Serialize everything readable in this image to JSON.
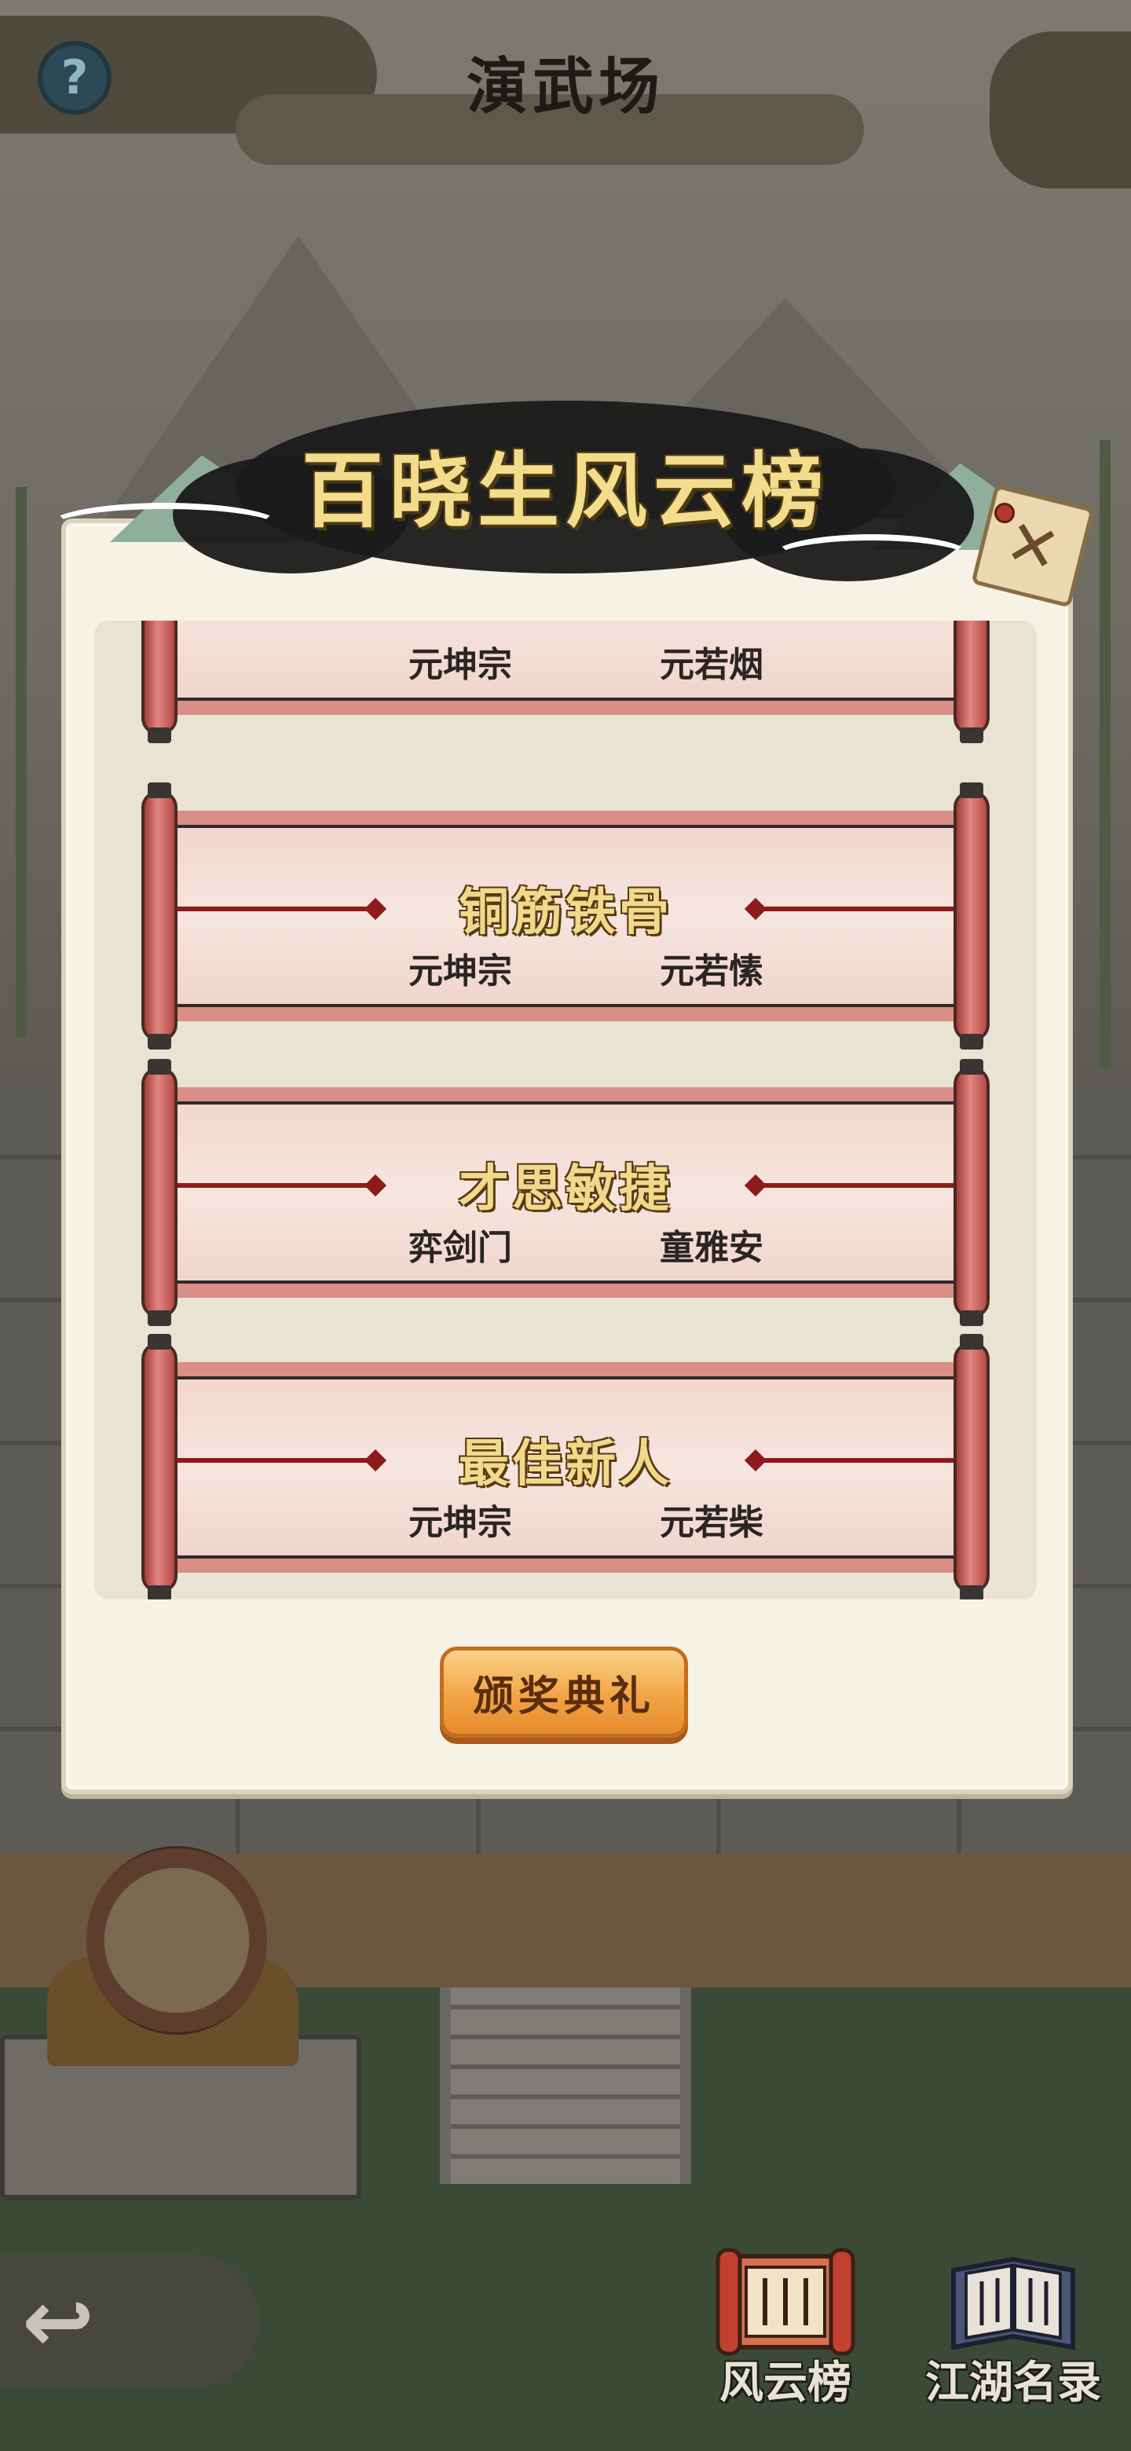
{
  "header": {
    "title": "演武场",
    "help_icon": "?"
  },
  "modal": {
    "title": "百晓生风云榜",
    "close_icon": "✕",
    "awards": [
      {
        "title": "",
        "sect": "元坤宗",
        "winner": "元若烟"
      },
      {
        "title": "铜筋铁骨",
        "sect": "元坤宗",
        "winner": "元若愫"
      },
      {
        "title": "才思敏捷",
        "sect": "弈剑门",
        "winner": "童雅安"
      },
      {
        "title": "最佳新人",
        "sect": "元坤宗",
        "winner": "元若柴"
      }
    ],
    "ceremony_button": "颁奖典礼"
  },
  "nav": {
    "back_icon": "↩",
    "items": [
      {
        "label": "风云榜",
        "icon": "scroll-ranking-icon"
      },
      {
        "label": "江湖名录",
        "icon": "book-directory-icon"
      }
    ]
  }
}
